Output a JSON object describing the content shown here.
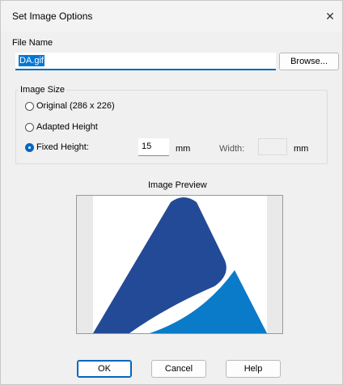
{
  "window": {
    "title": "Set Image Options",
    "close_icon": "close-icon",
    "close_glyph": "✕"
  },
  "file": {
    "label": "File Name",
    "value": "DA.gif",
    "browse_label": "Browse..."
  },
  "image_size": {
    "group_title": "Image Size",
    "options": [
      {
        "label": "Original (286 x 226)",
        "checked": false
      },
      {
        "label": "Adapted Height",
        "checked": false
      },
      {
        "label": "Fixed Height:",
        "checked": true
      }
    ],
    "height_value": "15",
    "height_unit": "mm",
    "width_label": "Width:",
    "width_value": "",
    "width_unit": "mm"
  },
  "preview": {
    "label": "Image Preview",
    "colors": {
      "dark": "#234a96",
      "light": "#0a7bc8"
    }
  },
  "buttons": {
    "ok": "OK",
    "cancel": "Cancel",
    "help": "Help"
  }
}
